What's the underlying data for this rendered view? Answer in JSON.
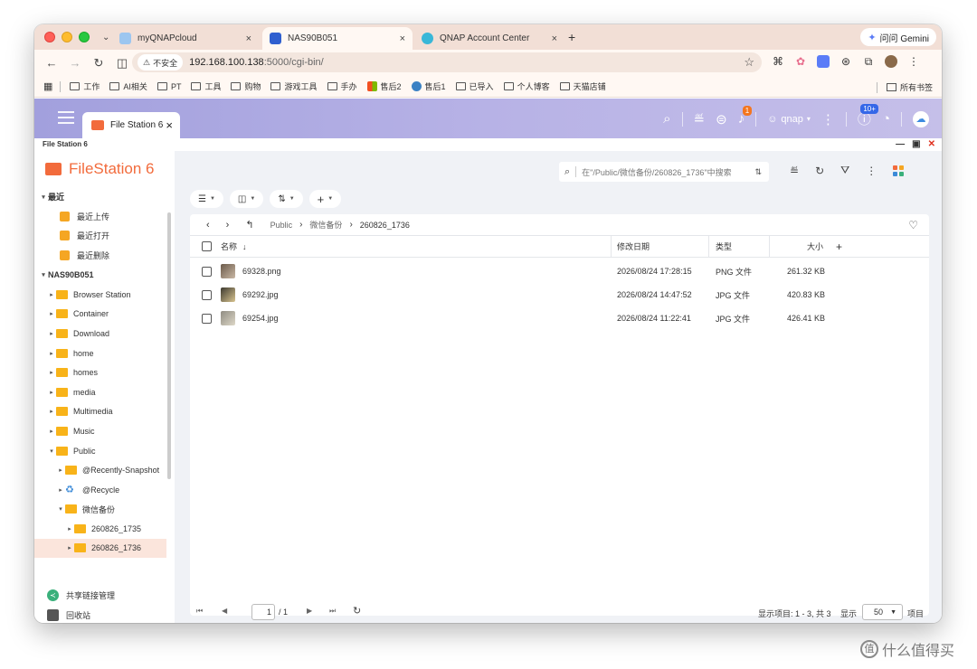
{
  "browser": {
    "tabs": [
      {
        "title": "myQNAPcloud",
        "active": false
      },
      {
        "title": "NAS90B051",
        "active": true
      },
      {
        "title": "QNAP Account Center",
        "active": false
      }
    ],
    "close_glyph": "×",
    "new_tab_glyph": "+",
    "gemini_label": "问问 Gemini",
    "security_badge": "不安全",
    "url_host": "192.168.100.138",
    "url_rest": ":5000/cgi-bin/",
    "bookmarks": [
      "工作",
      "AI相关",
      "PT",
      "工具",
      "购物",
      "游戏工具",
      "手办",
      "售后2",
      "售后1",
      "已导入",
      "个人博客",
      "天猫店铺"
    ],
    "all_bookmarks": "所有书签"
  },
  "qnap": {
    "app_tab_title": "File Station 6",
    "user": "qnap",
    "notification_count": "1",
    "update_count": "10+"
  },
  "app": {
    "window_title": "File Station 6",
    "brand": "FileStation 6"
  },
  "sidebar": {
    "recent_label": "最近",
    "recent_items": [
      "最近上传",
      "最近打开",
      "最近删除"
    ],
    "nas_label": "NAS90B051",
    "folders": [
      "Browser Station",
      "Container",
      "Download",
      "home",
      "homes",
      "media",
      "Multimedia",
      "Music",
      "Public"
    ],
    "public_children": [
      "@Recently-Snapshot",
      "@Recycle",
      "微信备份"
    ],
    "wechat_children": [
      "260826_1735",
      "260826_1736"
    ],
    "bottom": [
      "共享链接管理",
      "回收站"
    ]
  },
  "search": {
    "placeholder": "在\"/Public/微信备份/260826_1736\"中搜索"
  },
  "breadcrumb": [
    "Public",
    "微信备份",
    "260826_1736"
  ],
  "table": {
    "headers": {
      "name": "名称",
      "modified": "修改日期",
      "type": "类型",
      "size": "大小"
    },
    "rows": [
      {
        "name": "69328.png",
        "modified": "2026/08/24 17:28:15",
        "type": "PNG 文件",
        "size": "261.32 KB"
      },
      {
        "name": "69292.jpg",
        "modified": "2026/08/24 14:47:52",
        "type": "JPG 文件",
        "size": "420.83 KB"
      },
      {
        "name": "69254.jpg",
        "modified": "2026/08/24 11:22:41",
        "type": "JPG 文件",
        "size": "426.41 KB"
      }
    ]
  },
  "pager": {
    "page": "1",
    "total": "/ 1",
    "info": "显示项目: 1 - 3, 共 3",
    "show_label": "显示",
    "page_size": "50",
    "unit": "项目"
  },
  "watermark": "什么值得买",
  "colors": {
    "accent": "#f26b3c",
    "folder": "#f8b319",
    "header": "#b3afe4"
  }
}
